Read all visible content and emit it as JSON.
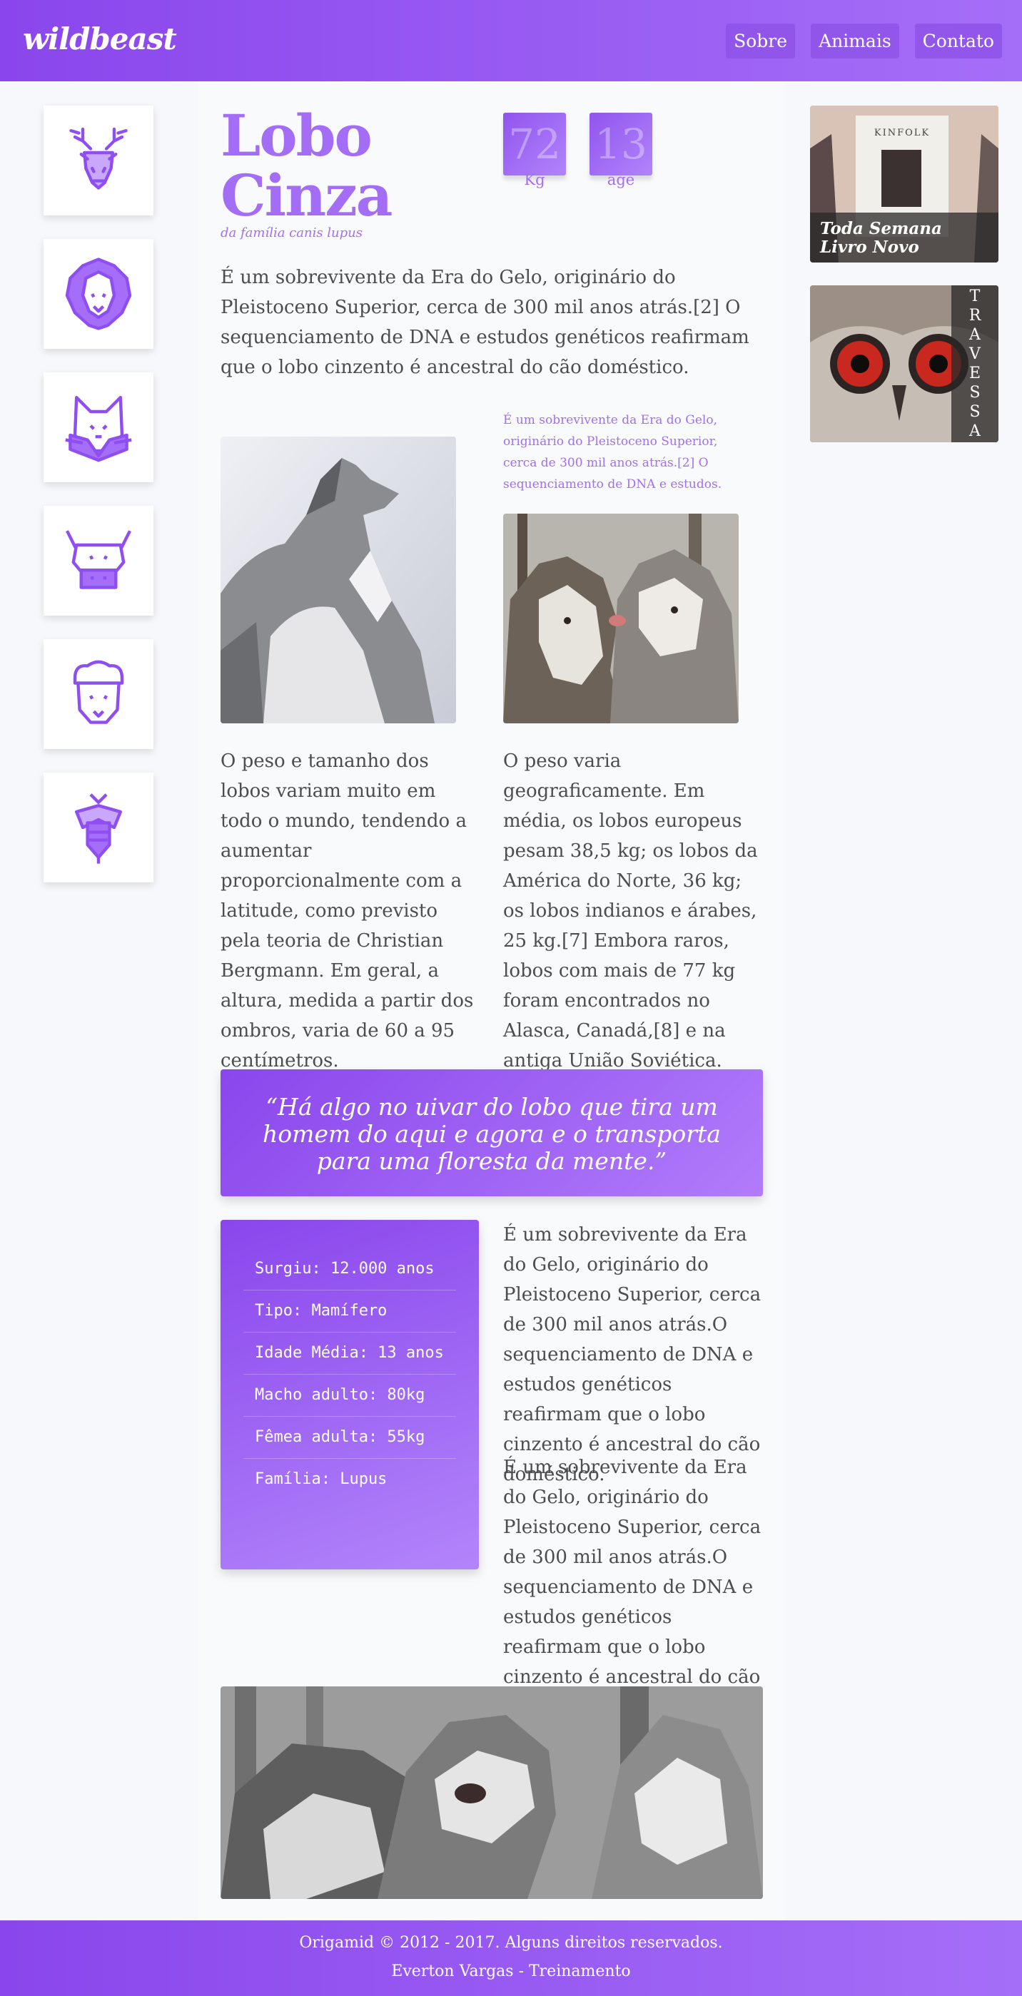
{
  "header": {
    "logo": "wildbeast",
    "nav": [
      "Sobre",
      "Animais",
      "Contato"
    ]
  },
  "left_icons": [
    "deer-icon",
    "lion-icon",
    "cat-icon",
    "bull-icon",
    "sheep-icon",
    "bee-icon"
  ],
  "article": {
    "title_line1": "Lobo",
    "title_line2": "Cinza",
    "subtitle": "da família canis lupus",
    "stats": [
      {
        "value": "72",
        "label": "Kg"
      },
      {
        "value": "13",
        "label": "age"
      }
    ],
    "intro": "É um sobrevivente da Era do Gelo, originário do Pleistoceno Superior, cerca de 300 mil anos atrás.[2] O sequenciamento de DNA e estudos genéticos reafirmam que o lobo cinzento é ancestral do cão doméstico.",
    "small_note": "É um sobrevivente da Era do Gelo, originário do Pleistoceno Superior, cerca de 300 mil anos atrás.[2] O sequenciamento de DNA e estudos.",
    "col_left": "O peso e tamanho dos lobos variam muito em todo o mundo, tendendo a aumentar proporcionalmente com a latitude, como previsto pela teoria de Christian Bergmann. Em geral, a altura, medida a partir dos ombros, varia de 60 a 95 centímetros.",
    "col_right": "O peso varia geograficamente. Em média, os lobos europeus pesam 38,5 kg; os lobos da América do Norte, 36 kg; os lobos indianos e árabes, 25 kg.[7] Embora raros, lobos com mais de 77 kg foram encontrados no Alasca, Canadá,[8] e na antiga União Soviética.",
    "quote": "“Há algo no uivar do lobo que tira um homem do aqui e agora e o transporta para uma floresta da mente.”",
    "facts": [
      "Surgiu: 12.000 anos",
      "Tipo: Mamífero",
      "Idade Média: 13 anos",
      "Macho adulto: 80kg",
      "Fêmea adulta: 55kg",
      "Família: Lupus"
    ],
    "side_para_1": "É um sobrevivente da Era do Gelo, originário do Pleistoceno Superior, cerca de 300 mil anos atrás.O sequenciamento de DNA e estudos genéticos reafirmam que o lobo cinzento é ancestral do cão doméstico.",
    "side_para_2": "É um sobrevivente da Era do Gelo, originário do Pleistoceno Superior, cerca de 300 mil anos atrás.O sequenciamento de DNA e estudos genéticos reafirmam que o lobo cinzento é ancestral do cão doméstico."
  },
  "sidebar": {
    "card1_line1": "Toda Semana",
    "card1_line2": "Livro Novo",
    "card1_magazine": "KINFOLK",
    "card2_letters": [
      "T",
      "R",
      "A",
      "V",
      "E",
      "S",
      "S",
      "A"
    ]
  },
  "footer": {
    "line1": "Origamid © 2012 - 2017. Alguns direitos reservados.",
    "line2": "Everton Vargas - Treinamento"
  },
  "colors": {
    "accent": "#a36ef5",
    "gradient_start": "#8a46ec",
    "gradient_end": "#a56ef8"
  }
}
